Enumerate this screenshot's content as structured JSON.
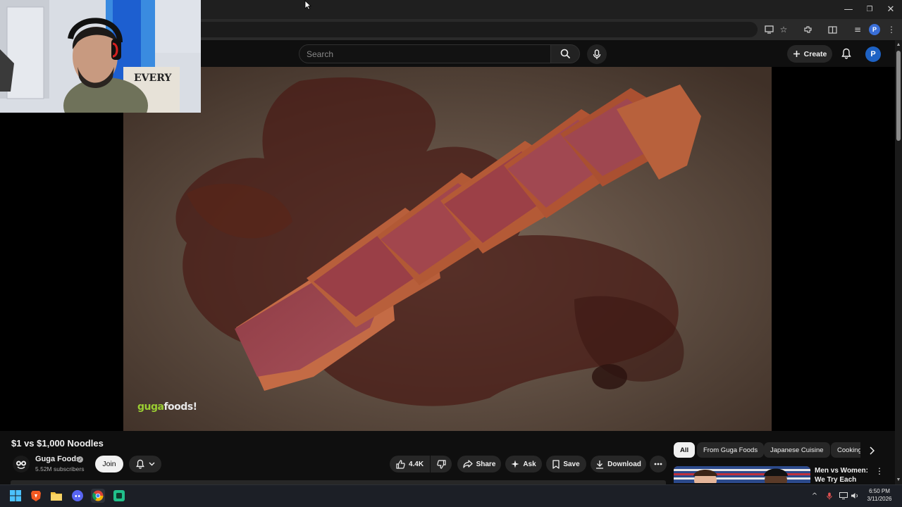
{
  "browser": {
    "window_controls": {
      "minimize": "—",
      "restore": "❐",
      "close": "✕"
    },
    "profile_initial": "P"
  },
  "masthead": {
    "search_placeholder": "Search",
    "create_label": "Create",
    "avatar_initial": "P"
  },
  "video": {
    "title": "$1 vs $1,000 Noodles",
    "watermark_part1": "guga",
    "watermark_part2": "foods!"
  },
  "channel": {
    "name": "Guga Foods",
    "subscribers": "5.52M subscribers",
    "join_label": "Join"
  },
  "actions": {
    "like_count": "4.4K",
    "share_label": "Share",
    "ask_label": "Ask",
    "save_label": "Save",
    "download_label": "Download"
  },
  "chips": [
    "All",
    "From Guga Foods",
    "Japanese Cuisine",
    "Cooking"
  ],
  "recommendation": {
    "title": "Men vs Women: We Try Each Other's ..."
  },
  "tray": {
    "time": "6:50 PM",
    "date": "3/11/2026"
  },
  "colors": {
    "background": "#0f0f0f",
    "chip_active": "#f1f1f1",
    "avatar": "#1e62c4",
    "taskbar": "#1c1f26"
  }
}
